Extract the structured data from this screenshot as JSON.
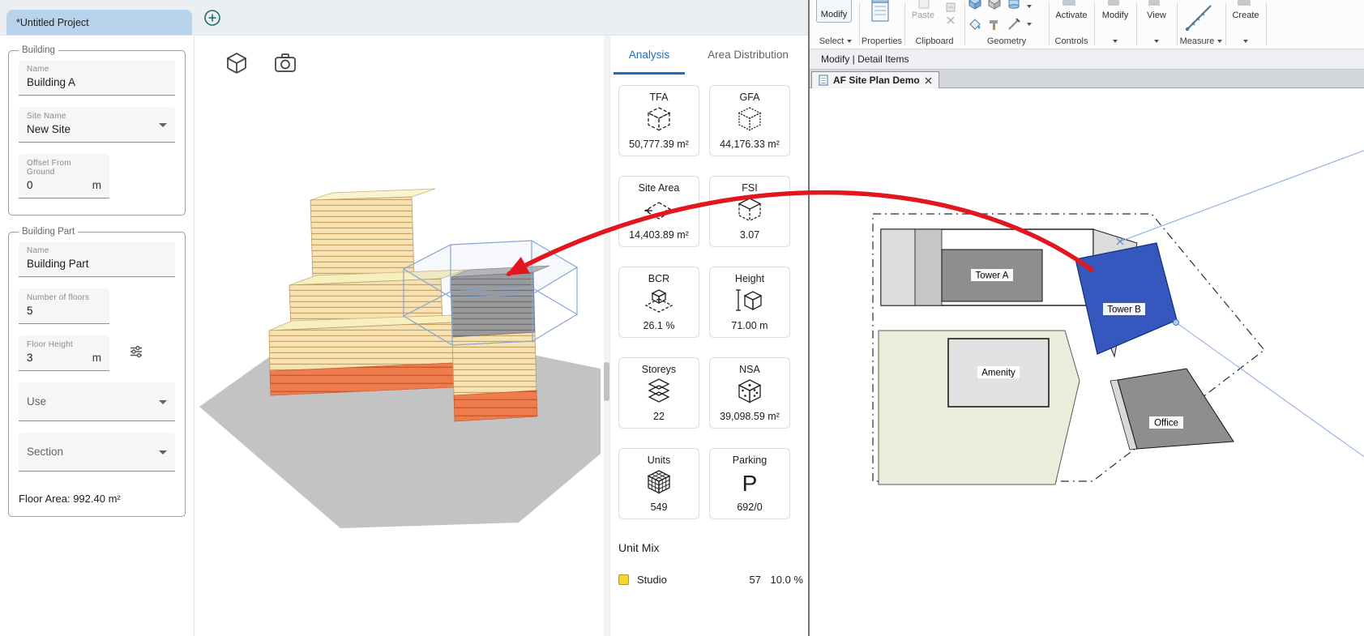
{
  "massing_app": {
    "tab_bar": {
      "project_tab": "*Untitled Project"
    },
    "building_panel": {
      "legend": "Building",
      "name": {
        "label": "Name",
        "value": "Building A"
      },
      "site_name": {
        "label": "Site Name",
        "value": "New Site"
      },
      "offset": {
        "label": "Offset From Ground",
        "value": "0",
        "unit": "m"
      }
    },
    "building_part_panel": {
      "legend": "Building Part",
      "name": {
        "label": "Name",
        "value": "Building Part"
      },
      "floors": {
        "label": "Number of floors",
        "value": "5"
      },
      "floor_height": {
        "label": "Floor Height",
        "value": "3",
        "unit": "m"
      },
      "use": {
        "label": "Use"
      },
      "section": {
        "label": "Section"
      },
      "floor_area": "Floor Area: 992.40 m²"
    },
    "analysis_panel": {
      "tab_analysis": "Analysis",
      "tab_area_distribution": "Area Distribution",
      "metrics": [
        {
          "label": "TFA",
          "value": "50,777.39 m²"
        },
        {
          "label": "GFA",
          "value": "44,176.33 m²"
        },
        {
          "label": "Site Area",
          "value": "14,403.89 m²"
        },
        {
          "label": "FSI",
          "value": "3.07"
        },
        {
          "label": "BCR",
          "value": "26.1 %"
        },
        {
          "label": "Height",
          "value": "71.00 m"
        },
        {
          "label": "Storeys",
          "value": "22"
        },
        {
          "label": "NSA",
          "value": "39,098.59 m²"
        },
        {
          "label": "Units",
          "value": "549"
        },
        {
          "label": "Parking",
          "value": "692/0",
          "symbol": "P"
        }
      ],
      "unit_mix": {
        "title": "Unit Mix",
        "rows": [
          {
            "label": "Studio",
            "count": "57",
            "pct": "10.0 %",
            "color": "#f7d52c"
          }
        ]
      }
    }
  },
  "revit": {
    "ribbon": {
      "modify_button": "Modify",
      "select_label": "Select",
      "properties_label": "Properties",
      "paste_button": "Paste",
      "clipboard_label": "Clipboard",
      "geometry_label": "Geometry",
      "activate_button": "Activate",
      "controls_label": "Controls",
      "modify_panel_label": "Modify",
      "view_panel_label": "View",
      "measure_label": "Measure",
      "create_panel_label": "Create"
    },
    "mode_bar": "Modify | Detail Items",
    "doc_tab": "AF Site Plan Demo",
    "site_plan": {
      "tower_a": "Tower A",
      "tower_b": "Tower B",
      "amenity": "Amenity",
      "office": "Office"
    },
    "accent_colors": {
      "selection_blue": "#3657be",
      "arrow_red": "#e3151d"
    }
  }
}
